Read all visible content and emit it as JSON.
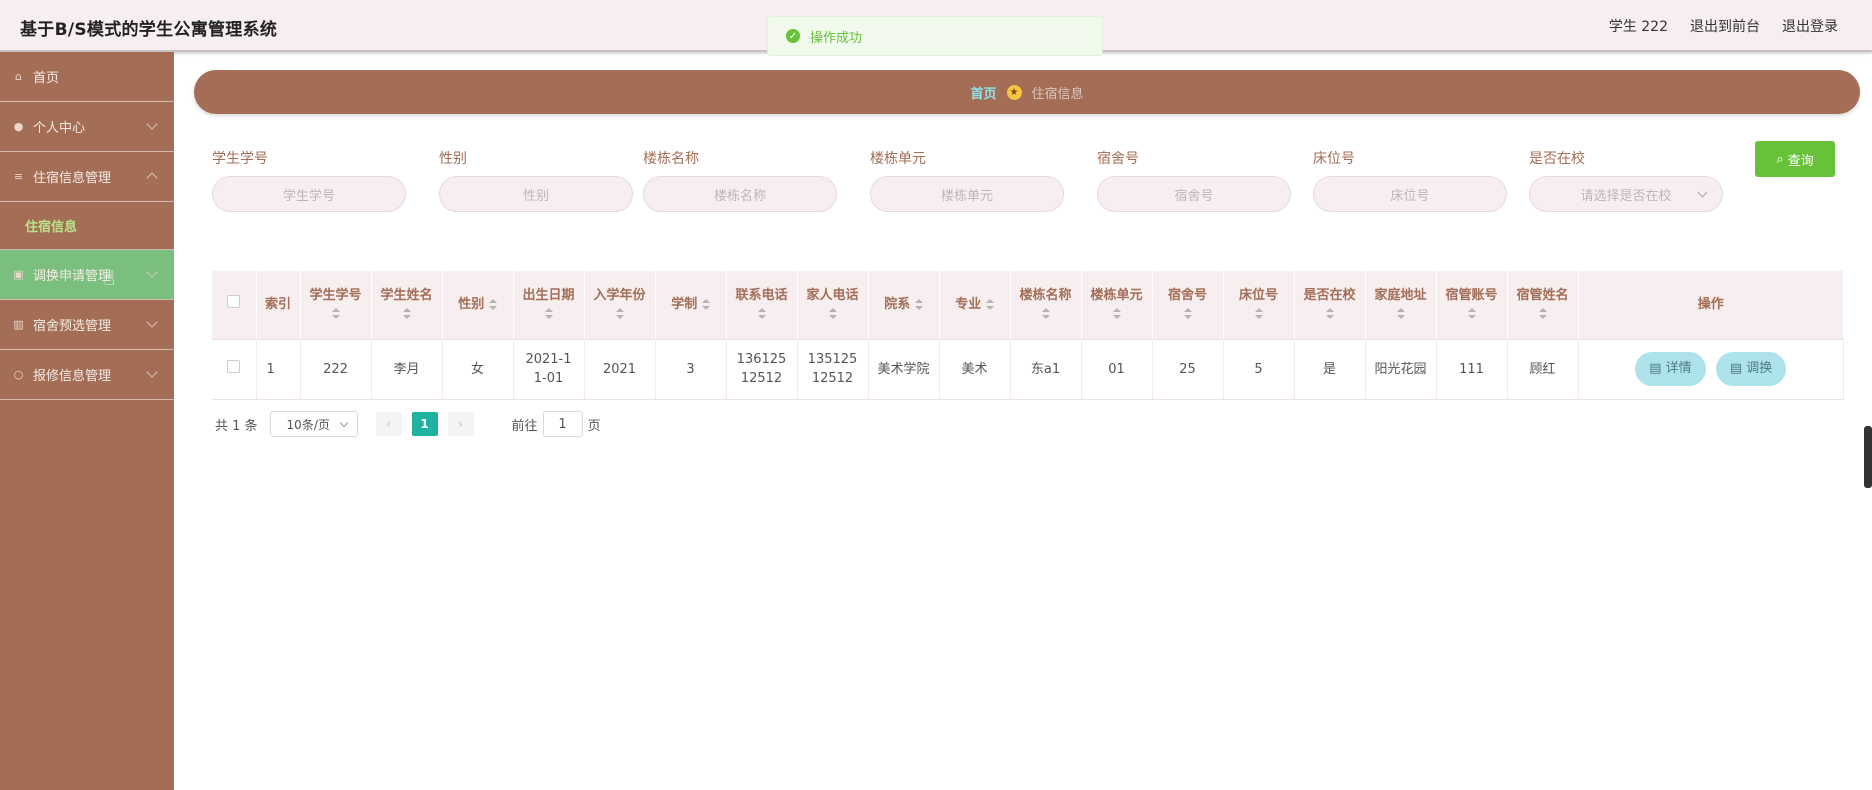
{
  "header": {
    "title": "基于B/S模式的学生公寓管理系统",
    "user": "学生 222",
    "to_front": "退出到前台",
    "logout": "退出登录"
  },
  "toast": {
    "text": "操作成功"
  },
  "sidebar": {
    "items": [
      {
        "label": "首页",
        "icon": "home-icon"
      },
      {
        "label": "个人中心",
        "icon": "user-icon"
      },
      {
        "label": "住宿信息管理",
        "icon": "menu-icon"
      },
      {
        "label": "住宿信息"
      },
      {
        "label": "调换申请管理",
        "icon": "cart-icon"
      },
      {
        "label": "宿舍预选管理",
        "icon": "chart-icon"
      },
      {
        "label": "报修信息管理",
        "icon": "search-icon"
      }
    ]
  },
  "breadcrumb": {
    "home": "首页",
    "current": "住宿信息"
  },
  "search": {
    "fields": [
      {
        "label": "学生学号",
        "placeholder": "学生学号"
      },
      {
        "label": "性别",
        "placeholder": "性别"
      },
      {
        "label": "楼栋名称",
        "placeholder": "楼栋名称"
      },
      {
        "label": "楼栋单元",
        "placeholder": "楼栋单元"
      },
      {
        "label": "宿舍号",
        "placeholder": "宿舍号"
      },
      {
        "label": "床位号",
        "placeholder": "床位号"
      },
      {
        "label": "是否在校",
        "placeholder": "请选择是否在校"
      }
    ],
    "query_button": "查询"
  },
  "table": {
    "columns": [
      "索引",
      "学生学号",
      "学生姓名",
      "性别",
      "出生日期",
      "入学年份",
      "学制",
      "联系电话",
      "家人电话",
      "院系",
      "专业",
      "楼栋名称",
      "楼栋单元",
      "宿舍号",
      "床位号",
      "是否在校",
      "家庭地址",
      "宿管账号",
      "宿管姓名",
      "操作"
    ],
    "rows": [
      [
        "1",
        "222",
        "李月",
        "女",
        "2021-11-01",
        "2021",
        "3",
        "13612512512",
        "13512512512",
        "美术学院",
        "美术",
        "东a1",
        "01",
        "25",
        "5",
        "是",
        "阳光花园",
        "111",
        "顾红"
      ]
    ],
    "actions": {
      "detail": "详情",
      "swap": "调换"
    }
  },
  "pagination": {
    "total": "共 1 条",
    "page_size": "10条/页",
    "current_page": "1",
    "goto_prefix": "前往",
    "goto_value": "1",
    "goto_suffix": "页"
  }
}
